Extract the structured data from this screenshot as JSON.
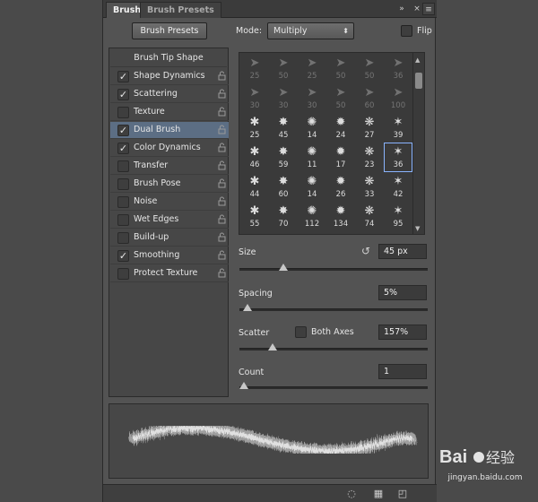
{
  "tabs": [
    {
      "label": "Brush",
      "active": true
    },
    {
      "label": "Brush Presets",
      "active": false
    }
  ],
  "tabbar_icons": {
    "collapse": "double-chevron-right-icon",
    "close": "close-icon",
    "menu": "panel-menu-icon"
  },
  "toolbar": {
    "presets_button": "Brush Presets",
    "mode_label": "Mode:",
    "mode_value": "Multiply",
    "flip_label": "Flip",
    "flip_checked": false
  },
  "options": {
    "header": "Brush Tip Shape",
    "items": [
      {
        "label": "Shape Dynamics",
        "checked": true,
        "selected": false
      },
      {
        "label": "Scattering",
        "checked": true,
        "selected": false
      },
      {
        "label": "Texture",
        "checked": false,
        "selected": false
      },
      {
        "label": "Dual Brush",
        "checked": true,
        "selected": true
      },
      {
        "label": "Color Dynamics",
        "checked": true,
        "selected": false
      },
      {
        "label": "Transfer",
        "checked": false,
        "selected": false
      },
      {
        "label": "Brush Pose",
        "checked": false,
        "selected": false
      },
      {
        "label": "Noise",
        "checked": false,
        "selected": false
      },
      {
        "label": "Wet Edges",
        "checked": false,
        "selected": false
      },
      {
        "label": "Build-up",
        "checked": false,
        "selected": false
      },
      {
        "label": "Smoothing",
        "checked": true,
        "selected": false
      },
      {
        "label": "Protect Texture",
        "checked": false,
        "selected": false
      }
    ],
    "check_glyph": "✓",
    "lock_icon": "lock-icon"
  },
  "brush_grid": {
    "rows": [
      {
        "dim": true,
        "sizes": [
          "25",
          "50",
          "25",
          "50",
          "50",
          "36"
        ]
      },
      {
        "dim": true,
        "sizes": [
          "30",
          "30",
          "30",
          "50",
          "60",
          "100"
        ]
      },
      {
        "dim": false,
        "sizes": [
          "25",
          "45",
          "14",
          "24",
          "27",
          "39"
        ]
      },
      {
        "dim": false,
        "sizes": [
          "46",
          "59",
          "11",
          "17",
          "23",
          "36"
        ]
      },
      {
        "dim": false,
        "sizes": [
          "44",
          "60",
          "14",
          "26",
          "33",
          "42"
        ]
      },
      {
        "dim": false,
        "sizes": [
          "55",
          "70",
          "112",
          "134",
          "74",
          "95"
        ]
      }
    ],
    "selected": {
      "row": 3,
      "col": 5
    }
  },
  "params": {
    "size": {
      "label": "Size",
      "value": "45 px",
      "slider_level": 0.22
    },
    "spacing": {
      "label": "Spacing",
      "value": "5%",
      "slider_level": 0.02
    },
    "scatter": {
      "label": "Scatter",
      "both_axes_label": "Both Axes",
      "both_axes_checked": false,
      "value": "157%",
      "slider_level": 0.16
    },
    "count": {
      "label": "Count",
      "value": "1",
      "slider_level": 0.0
    }
  },
  "bottom_icons": [
    "toggle-preview-icon",
    "grid-icon",
    "new-brush-icon"
  ],
  "watermark": {
    "text": "jingyan.baidu.com"
  }
}
